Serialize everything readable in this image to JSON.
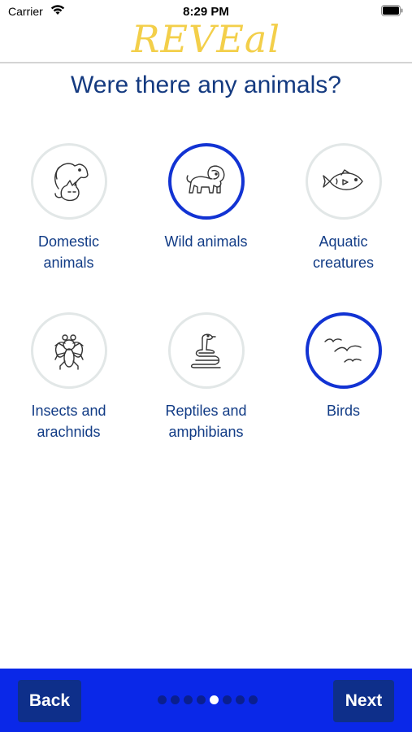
{
  "status": {
    "carrier": "Carrier",
    "time": "8:29 PM"
  },
  "header": {
    "logo": "REVEal"
  },
  "page": {
    "title": "Were there any animals?"
  },
  "options": [
    {
      "label": "Domestic animals",
      "icon": "dog-cat-icon",
      "selected": false
    },
    {
      "label": "Wild animals",
      "icon": "lion-icon",
      "selected": true
    },
    {
      "label": "Aquatic creatures",
      "icon": "fish-icon",
      "selected": false
    },
    {
      "label": "Insects and arachnids",
      "icon": "fly-icon",
      "selected": false
    },
    {
      "label": "Reptiles and amphibians",
      "icon": "snake-icon",
      "selected": false
    },
    {
      "label": "Birds",
      "icon": "birds-icon",
      "selected": true
    }
  ],
  "footer": {
    "back_label": "Back",
    "next_label": "Next",
    "page_count": 8,
    "current_page": 5
  },
  "colors": {
    "accent": "#1233d3",
    "bar": "#0a28e8",
    "button": "#0e2f8a",
    "text": "#143a80",
    "logo": "#f3cf4a"
  }
}
